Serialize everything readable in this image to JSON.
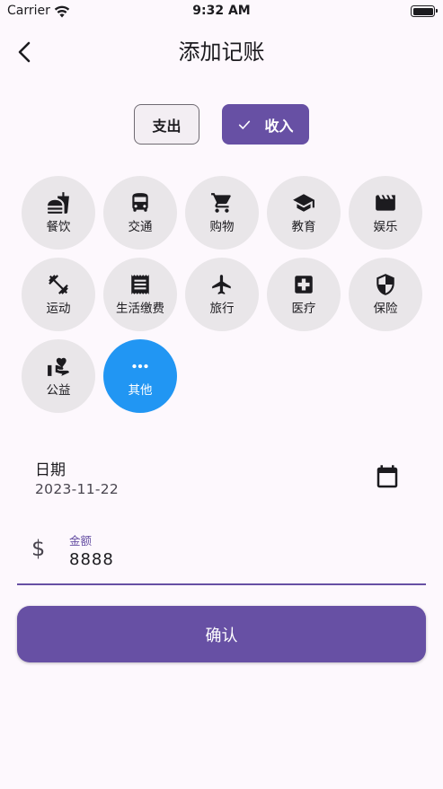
{
  "status_bar": {
    "carrier": "Carrier",
    "time": "9:32 AM"
  },
  "app_bar": {
    "title": "添加记账"
  },
  "type_toggle": {
    "expense_label": "支出",
    "income_label": "收入",
    "selected": "income"
  },
  "categories": [
    {
      "label": "餐饮",
      "icon": "fastfood-icon"
    },
    {
      "label": "交通",
      "icon": "bus-icon"
    },
    {
      "label": "购物",
      "icon": "cart-icon"
    },
    {
      "label": "教育",
      "icon": "school-icon"
    },
    {
      "label": "娱乐",
      "icon": "movie-icon"
    },
    {
      "label": "运动",
      "icon": "fitness-icon"
    },
    {
      "label": "生活缴费",
      "icon": "receipt-icon"
    },
    {
      "label": "旅行",
      "icon": "flight-icon"
    },
    {
      "label": "医疗",
      "icon": "medical-icon"
    },
    {
      "label": "保险",
      "icon": "shield-icon"
    },
    {
      "label": "公益",
      "icon": "charity-icon"
    },
    {
      "label": "其他",
      "icon": "more-icon",
      "selected": true
    }
  ],
  "date": {
    "label": "日期",
    "value": "2023-11-22"
  },
  "amount": {
    "label": "金额",
    "value": "8888",
    "icon": "dollar-icon"
  },
  "confirm_label": "确认",
  "colors": {
    "primary": "#6750a4",
    "selected_category": "#2196f3",
    "category_bg": "#e9e6e9",
    "background": "#fdf8fd"
  }
}
